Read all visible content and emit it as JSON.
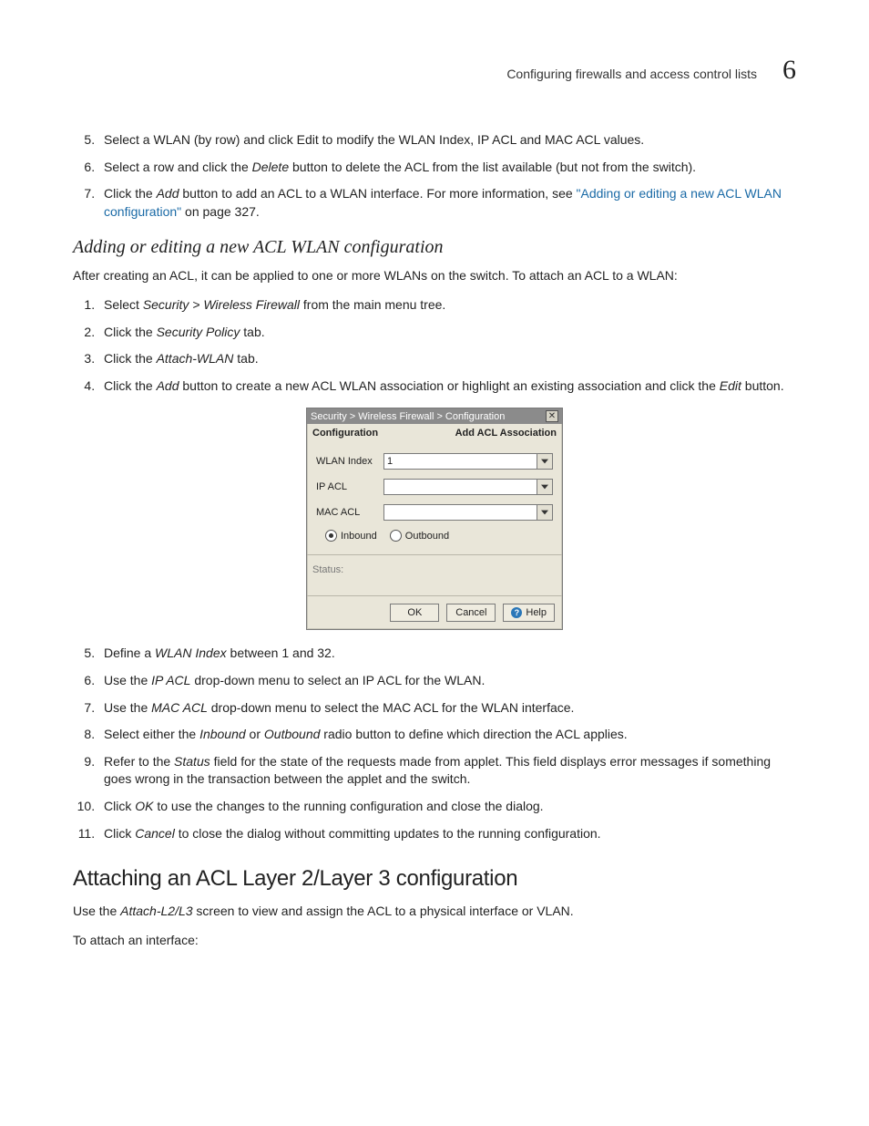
{
  "header": {
    "section": "Configuring firewalls and access control lists",
    "chapter_number": "6"
  },
  "steps_a": [
    {
      "n": "5.",
      "pre": "Select a WLAN (by row) and click Edit to modify the WLAN Index, IP ACL and MAC ACL values."
    },
    {
      "n": "6.",
      "pre": "Select a row and click the ",
      "em": "Delete",
      "post": " button to delete the ACL from the list available (but not from the switch)."
    },
    {
      "n": "7.",
      "pre": "Click the ",
      "em": "Add",
      "post": " button to add an ACL to a WLAN interface. For more information, see ",
      "link": "\"Adding or editing a new ACL WLAN configuration\"",
      "after_link": " on page 327."
    }
  ],
  "subhead1": "Adding or editing a new ACL WLAN configuration",
  "intro1": "After creating an ACL, it can be applied to one or more WLANs on the switch. To attach an ACL to a WLAN:",
  "steps_b": [
    {
      "n": "1.",
      "pre": "Select ",
      "em": "Security > Wireless Firewall",
      "post": " from the main menu tree."
    },
    {
      "n": "2.",
      "pre": "Click the ",
      "em": "Security Policy",
      "post": " tab."
    },
    {
      "n": "3.",
      "pre": "Click the ",
      "em": "Attach-WLAN",
      "post": " tab."
    },
    {
      "n": "4.",
      "pre": "Click the ",
      "em": "Add",
      "post": " button to create a new ACL WLAN association or highlight an existing association and click the ",
      "em2": "Edit",
      "post2": " button."
    }
  ],
  "dialog": {
    "breadcrumb": "Security > Wireless Firewall > Configuration",
    "tab_left": "Configuration",
    "tab_right": "Add ACL Association",
    "fields": {
      "wlan_index_label": "WLAN Index",
      "wlan_index_value": "1",
      "ip_acl_label": "IP ACL",
      "ip_acl_value": "",
      "mac_acl_label": "MAC ACL",
      "mac_acl_value": ""
    },
    "radios": {
      "inbound": "Inbound",
      "outbound": "Outbound"
    },
    "status_label": "Status:",
    "buttons": {
      "ok": "OK",
      "cancel": "Cancel",
      "help": "Help"
    }
  },
  "steps_c": [
    {
      "n": "5.",
      "pre": "Define a ",
      "em": "WLAN Index",
      "post": " between 1 and 32."
    },
    {
      "n": "6.",
      "pre": "Use the ",
      "em": "IP ACL",
      "post": " drop-down menu to select an IP ACL for the WLAN."
    },
    {
      "n": "7.",
      "pre": "Use the ",
      "em": "MAC ACL",
      "post": " drop-down menu to select the MAC ACL for the WLAN interface."
    },
    {
      "n": "8.",
      "pre": "Select either the ",
      "em": "Inbound",
      "mid": " or ",
      "em2": "Outbound",
      "post": " radio button to define which direction the ACL applies."
    },
    {
      "n": "9.",
      "pre": "Refer to the ",
      "em": "Status",
      "post": " field for the state of the requests made from applet. This field displays error messages if something goes wrong in the transaction between the applet and the switch."
    },
    {
      "n": "10.",
      "pre": "Click ",
      "em": "OK",
      "post": " to use the changes to the running configuration and close the dialog."
    },
    {
      "n": "11.",
      "pre": "Click ",
      "em": "Cancel",
      "post": " to close the dialog without committing updates to the running configuration."
    }
  ],
  "h2": "Attaching an ACL Layer 2/Layer 3 configuration",
  "para2_pre": "Use the ",
  "para2_em": "Attach-L2/L3",
  "para2_post": " screen to view and assign the ACL to a physical interface or VLAN.",
  "para3": "To attach an interface:"
}
